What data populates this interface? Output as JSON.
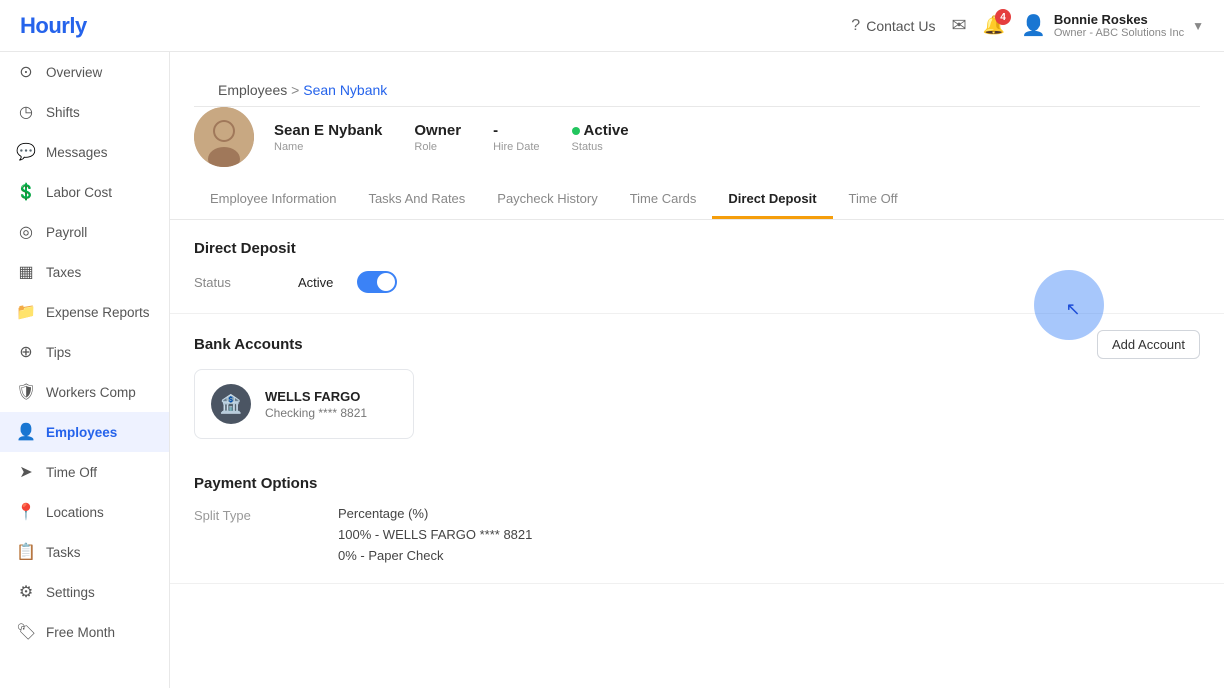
{
  "app": {
    "logo": "Hourly"
  },
  "topnav": {
    "contact_icon": "?",
    "contact_label": "Contact Us",
    "messages_icon": "💬",
    "notifications_icon": "🔔",
    "notification_count": "4",
    "user_name": "Bonnie Roskes",
    "user_role": "Owner - ABC Solutions Inc",
    "chevron": "▼"
  },
  "sidebar": {
    "items": [
      {
        "id": "overview",
        "label": "Overview",
        "icon": "⊙",
        "active": false
      },
      {
        "id": "shifts",
        "label": "Shifts",
        "icon": "◷",
        "active": false
      },
      {
        "id": "messages",
        "label": "Messages",
        "icon": "💬",
        "active": false
      },
      {
        "id": "labor-cost",
        "label": "Labor Cost",
        "icon": "💲",
        "active": false
      },
      {
        "id": "payroll",
        "label": "Payroll",
        "icon": "◎",
        "active": false
      },
      {
        "id": "taxes",
        "label": "Taxes",
        "icon": "▦",
        "active": false
      },
      {
        "id": "expense-reports",
        "label": "Expense Reports",
        "icon": "📁",
        "active": false
      },
      {
        "id": "tips",
        "label": "Tips",
        "icon": "⊕",
        "active": false
      },
      {
        "id": "workers-comp",
        "label": "Workers Comp",
        "icon": "🛡",
        "active": false
      },
      {
        "id": "employees",
        "label": "Employees",
        "icon": "👤",
        "active": true
      },
      {
        "id": "time-off",
        "label": "Time Off",
        "icon": "➤",
        "active": false
      },
      {
        "id": "locations",
        "label": "Locations",
        "icon": "📍",
        "active": false
      },
      {
        "id": "tasks",
        "label": "Tasks",
        "icon": "📋",
        "active": false
      },
      {
        "id": "settings",
        "label": "Settings",
        "icon": "⚙",
        "active": false
      },
      {
        "id": "free-month",
        "label": "Free Month",
        "icon": "🏷",
        "active": false
      }
    ]
  },
  "breadcrumb": {
    "parent": "Employees",
    "separator": " > ",
    "current": "Sean Nybank"
  },
  "employee": {
    "name": "Sean E Nybank",
    "name_label": "Name",
    "role": "Owner",
    "role_label": "Role",
    "hire_date": "-",
    "hire_date_label": "Hire Date",
    "status": "Active",
    "status_label": "Status"
  },
  "tabs": [
    {
      "id": "employee-information",
      "label": "Employee Information",
      "active": false
    },
    {
      "id": "tasks-and-rates",
      "label": "Tasks And Rates",
      "active": false
    },
    {
      "id": "paycheck-history",
      "label": "Paycheck History",
      "active": false
    },
    {
      "id": "time-cards",
      "label": "Time Cards",
      "active": false
    },
    {
      "id": "direct-deposit",
      "label": "Direct Deposit",
      "active": true
    },
    {
      "id": "time-off",
      "label": "Time Off",
      "active": false
    }
  ],
  "direct_deposit": {
    "section_title": "Direct Deposit",
    "status_label": "Status",
    "status_value": "Active",
    "bank_accounts_title": "Bank Accounts",
    "add_account_label": "Add Account",
    "bank_name": "WELLS FARGO",
    "bank_type": "Checking **** 8821",
    "payment_options_title": "Payment Options",
    "split_type_label": "Split Type",
    "split_type_value": "Percentage (%)",
    "split_options": [
      "100% - WELLS FARGO **** 8821",
      "0% - Paper Check"
    ]
  }
}
